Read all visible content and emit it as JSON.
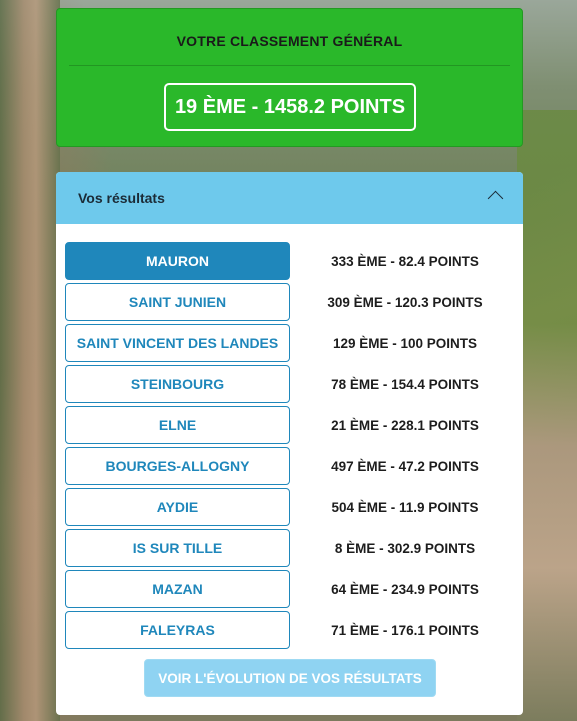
{
  "summary": {
    "title": "VOTRE CLASSEMENT GÉNÉRAL",
    "overall": "19 ÈME - 1458.2 POINTS"
  },
  "results": {
    "title": "Vos résultats",
    "toggle_icon": "chevron-up-icon",
    "rows": [
      {
        "event": "MAURON",
        "result": "333 ÈME - 82.4 POINTS",
        "active": true
      },
      {
        "event": "SAINT JUNIEN",
        "result": "309 ÈME - 120.3 POINTS",
        "active": false
      },
      {
        "event": "SAINT VINCENT DES LANDES",
        "result": "129 ÈME - 100 POINTS",
        "active": false
      },
      {
        "event": "STEINBOURG",
        "result": "78 ÈME - 154.4 POINTS",
        "active": false
      },
      {
        "event": "ELNE",
        "result": "21 ÈME - 228.1 POINTS",
        "active": false
      },
      {
        "event": "BOURGES-ALLOGNY",
        "result": "497 ÈME - 47.2 POINTS",
        "active": false
      },
      {
        "event": "AYDIE",
        "result": "504 ÈME - 11.9 POINTS",
        "active": false
      },
      {
        "event": "IS SUR TILLE",
        "result": "8 ÈME - 302.9 POINTS",
        "active": false
      },
      {
        "event": "MAZAN",
        "result": "64 ÈME - 234.9 POINTS",
        "active": false
      },
      {
        "event": "FALEYRAS",
        "result": "71 ÈME - 176.1 POINTS",
        "active": false
      }
    ],
    "evolution_button": "VOIR L'ÉVOLUTION DE VOS RÉSULTATS"
  },
  "colors": {
    "summary_bg": "#2ab82a",
    "header_bg": "#6ec9ec",
    "accent_blue": "#1f87bb",
    "evolution_button_bg": "#8fd3f2"
  }
}
